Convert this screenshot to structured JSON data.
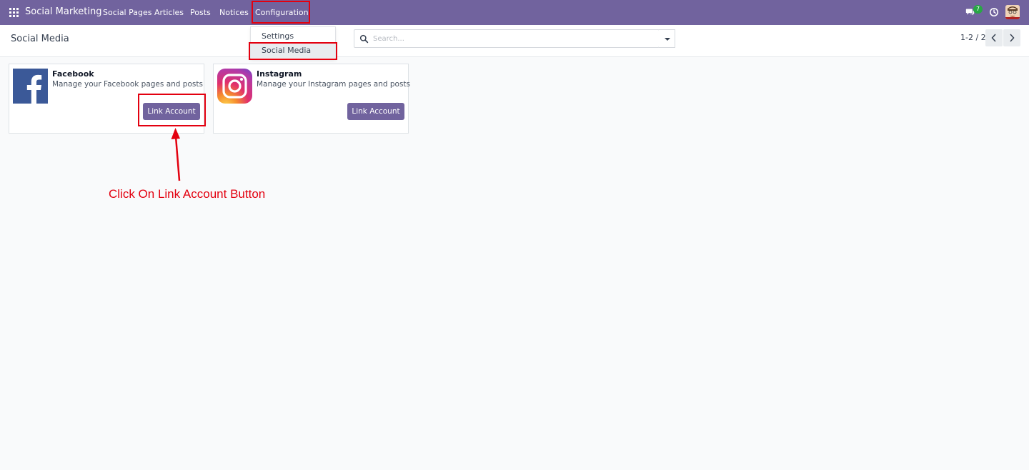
{
  "navbar": {
    "apps_icon": "grid-icon",
    "brand": "Social Marketing",
    "menu": [
      {
        "label": "Social Pages"
      },
      {
        "label": "Articles"
      },
      {
        "label": "Posts"
      },
      {
        "label": "Notices"
      },
      {
        "label": "Configuration"
      }
    ],
    "chat_icon": "chat-icon",
    "chat_badge": "7",
    "clock_icon": "clock-icon",
    "avatar": "user-avatar"
  },
  "control_panel": {
    "breadcrumb": "Social Media",
    "search": {
      "placeholder": "Search...",
      "value": ""
    },
    "pager": "1-2 / 2"
  },
  "dropdown": {
    "items": [
      {
        "label": "Settings"
      },
      {
        "label": "Social Media"
      }
    ]
  },
  "cards": [
    {
      "title": "Facebook",
      "description": "Manage your Facebook pages and posts",
      "button": "Link Account",
      "icon": "facebook-logo"
    },
    {
      "title": "Instagram",
      "description": "Manage your Instagram pages and posts",
      "button": "Link Account",
      "icon": "instagram-logo"
    }
  ],
  "annotation": {
    "text": "Click On Link Account Button"
  },
  "colors": {
    "navbar": "#71639e",
    "button": "#71639e",
    "highlight": "#e3000f",
    "badge": "#28a745",
    "facebook": "#3b5998"
  }
}
